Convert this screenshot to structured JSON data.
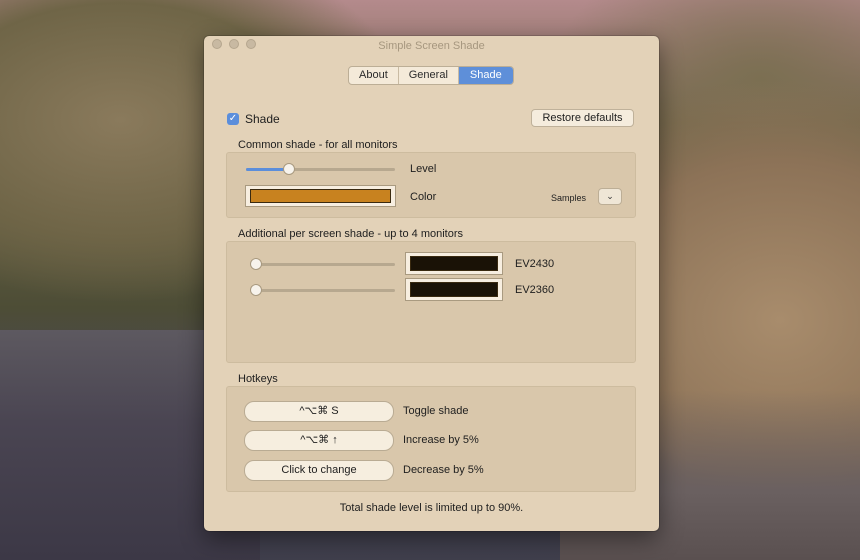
{
  "window": {
    "title": "Simple Screen Shade"
  },
  "tabs": [
    {
      "label": "About",
      "active": false
    },
    {
      "label": "General",
      "active": false
    },
    {
      "label": "Shade",
      "active": true
    }
  ],
  "shade_toggle": {
    "label": "Shade",
    "checked": true
  },
  "restore_button": "Restore defaults",
  "common": {
    "title": "Common shade - for all monitors",
    "level_label": "Level",
    "level_value": 0.27,
    "color_label": "Color",
    "color": "#c8821f",
    "samples_label": "Samples"
  },
  "per_screen": {
    "title": "Additional per screen shade - up to 4 monitors",
    "monitors": [
      {
        "name": "EV2430",
        "level": 0.0,
        "color": "#1a1206"
      },
      {
        "name": "EV2360",
        "level": 0.0,
        "color": "#1a1206"
      }
    ]
  },
  "hotkeys": {
    "title": "Hotkeys",
    "items": [
      {
        "key": "^⌥⌘ S",
        "action": "Toggle shade"
      },
      {
        "key": "^⌥⌘ ↑",
        "action": "Increase by 5%"
      },
      {
        "key": "Click to change",
        "action": "Decrease by 5%"
      }
    ]
  },
  "footer_note": "Total shade level is limited up to 90%.",
  "colors": {
    "accent": "#5b8edb",
    "window_bg": "#e3d2b8"
  }
}
